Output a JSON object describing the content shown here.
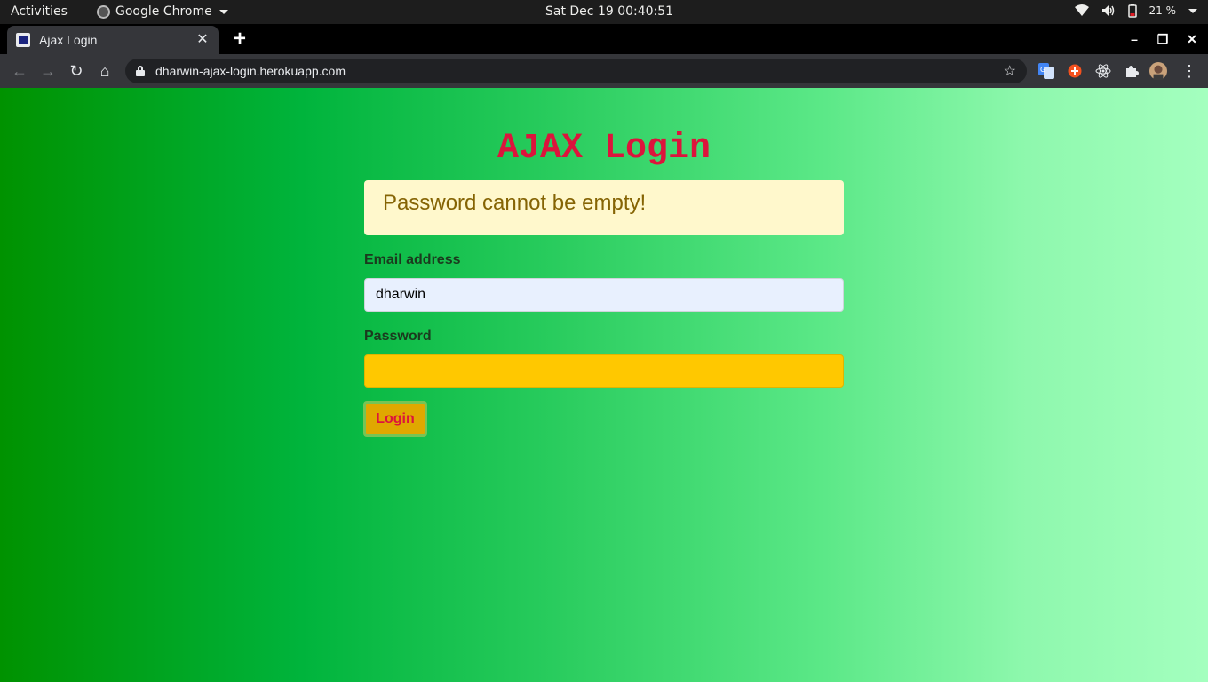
{
  "system_bar": {
    "activities": "Activities",
    "app_name": "Google Chrome",
    "clock": "Sat Dec 19  00:40:51",
    "battery": "21 %"
  },
  "browser": {
    "tab_title": "Ajax Login",
    "url": "dharwin-ajax-login.herokuapp.com"
  },
  "page": {
    "title": "AJAX Login",
    "alert": "Password cannot be empty!",
    "email_label": "Email address",
    "email_value": "dharwin",
    "password_label": "Password",
    "password_value": "",
    "login_button": "Login",
    "colors": {
      "title": "#dc143c",
      "alert_bg": "#fff8cc",
      "alert_text": "#856404",
      "password_bg": "#ffc800",
      "button_bg": "#e0a800"
    }
  }
}
